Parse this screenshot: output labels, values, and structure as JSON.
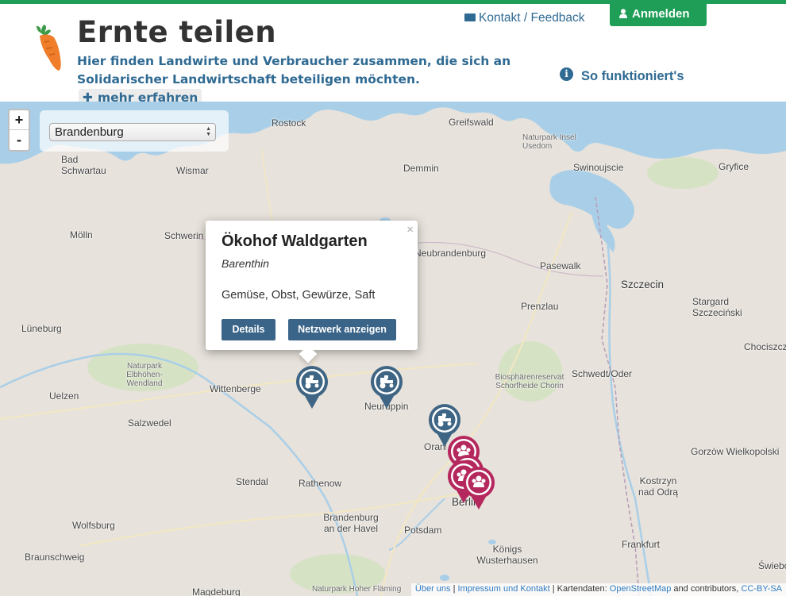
{
  "header": {
    "title": "Ernte teilen",
    "subtitle": "Hier finden Landwirte und Verbraucher zusammen, die sich an Solidarischer Landwirtschaft beteiligen möchten.",
    "more_label": "mehr erfahren",
    "contact_label": "Kontakt / Feedback",
    "login_label": "Anmelden",
    "info_label": "So funktioniert's",
    "icons": {
      "logo": "carrot-icon",
      "more": "plus-icon",
      "contact": "envelope-icon",
      "login": "user-icon",
      "info": "info-circle-icon"
    }
  },
  "colors": {
    "accent_green": "#1e9e57",
    "text_blue": "#2f6a93",
    "button_blue": "#3a6488",
    "farm_marker": "#3e6583",
    "consumer_marker": "#b5285d",
    "water": "#a9cfe8",
    "land": "#e7e2db",
    "forest": "#d4e1c0"
  },
  "map": {
    "zoom_in": "+",
    "zoom_out": "-",
    "region_select": {
      "selected": "Brandenburg"
    },
    "places": [
      "Rostock",
      "Greifswald",
      "Naturpark Insel Usedom",
      "Bad Schwartau",
      "Wismar",
      "Demmin",
      "Swinoujscie",
      "Gryfice",
      "Mölln",
      "Schwerin",
      "Neubrandenburg",
      "Pasewalk",
      "Szczecin",
      "Lüneburg",
      "Prenzlau",
      "Stargard Szczeciński",
      "Naturpark Elbhöhen-Wendland",
      "Wittenberge",
      "Neuruppin",
      "Biosphärenreservat Schorfheide Chorin",
      "Schwedt/Oder",
      "Chociszczno",
      "Uelzen",
      "Salzwedel",
      "Oranienburg",
      "Gorzów Wielkopolski",
      "Stendal",
      "Rathenow",
      "Berlin",
      "Kostrzyn nad Odrą",
      "Wolfsburg",
      "Brandenburg an der Havel",
      "Potsdam",
      "Frankfurt",
      "Königs Wusterhausen",
      "Braunschweig",
      "Magdeburg",
      "Naturpark Hoher Fläming",
      "Świebo"
    ],
    "popup": {
      "title": "Ökohof Waldgarten",
      "location": "Barenthin",
      "products": "Gemüse, Obst, Gewürze, Saft",
      "details_label": "Details",
      "network_label": "Netzwerk anzeigen",
      "close_label": "×"
    },
    "farm_markers": [
      {
        "name": "Ökohof Waldgarten",
        "type": "tractor-icon"
      },
      {
        "name": "Neuruppin farm",
        "type": "tractor-icon"
      },
      {
        "name": "Oranienburg farm",
        "type": "tractor-icon"
      }
    ],
    "consumer_markers": [
      {
        "type": "group-icon"
      },
      {
        "type": "group-icon"
      },
      {
        "type": "group-icon"
      },
      {
        "type": "group-icon"
      }
    ],
    "attribution": {
      "about": "Über uns",
      "sep1": " | ",
      "imprint": "Impressum und Kontakt",
      "sep2": " | Kartendaten: ",
      "osm": "OpenStreetMap",
      "contributors": " and contributors, ",
      "license": "CC-BY-SA"
    }
  }
}
